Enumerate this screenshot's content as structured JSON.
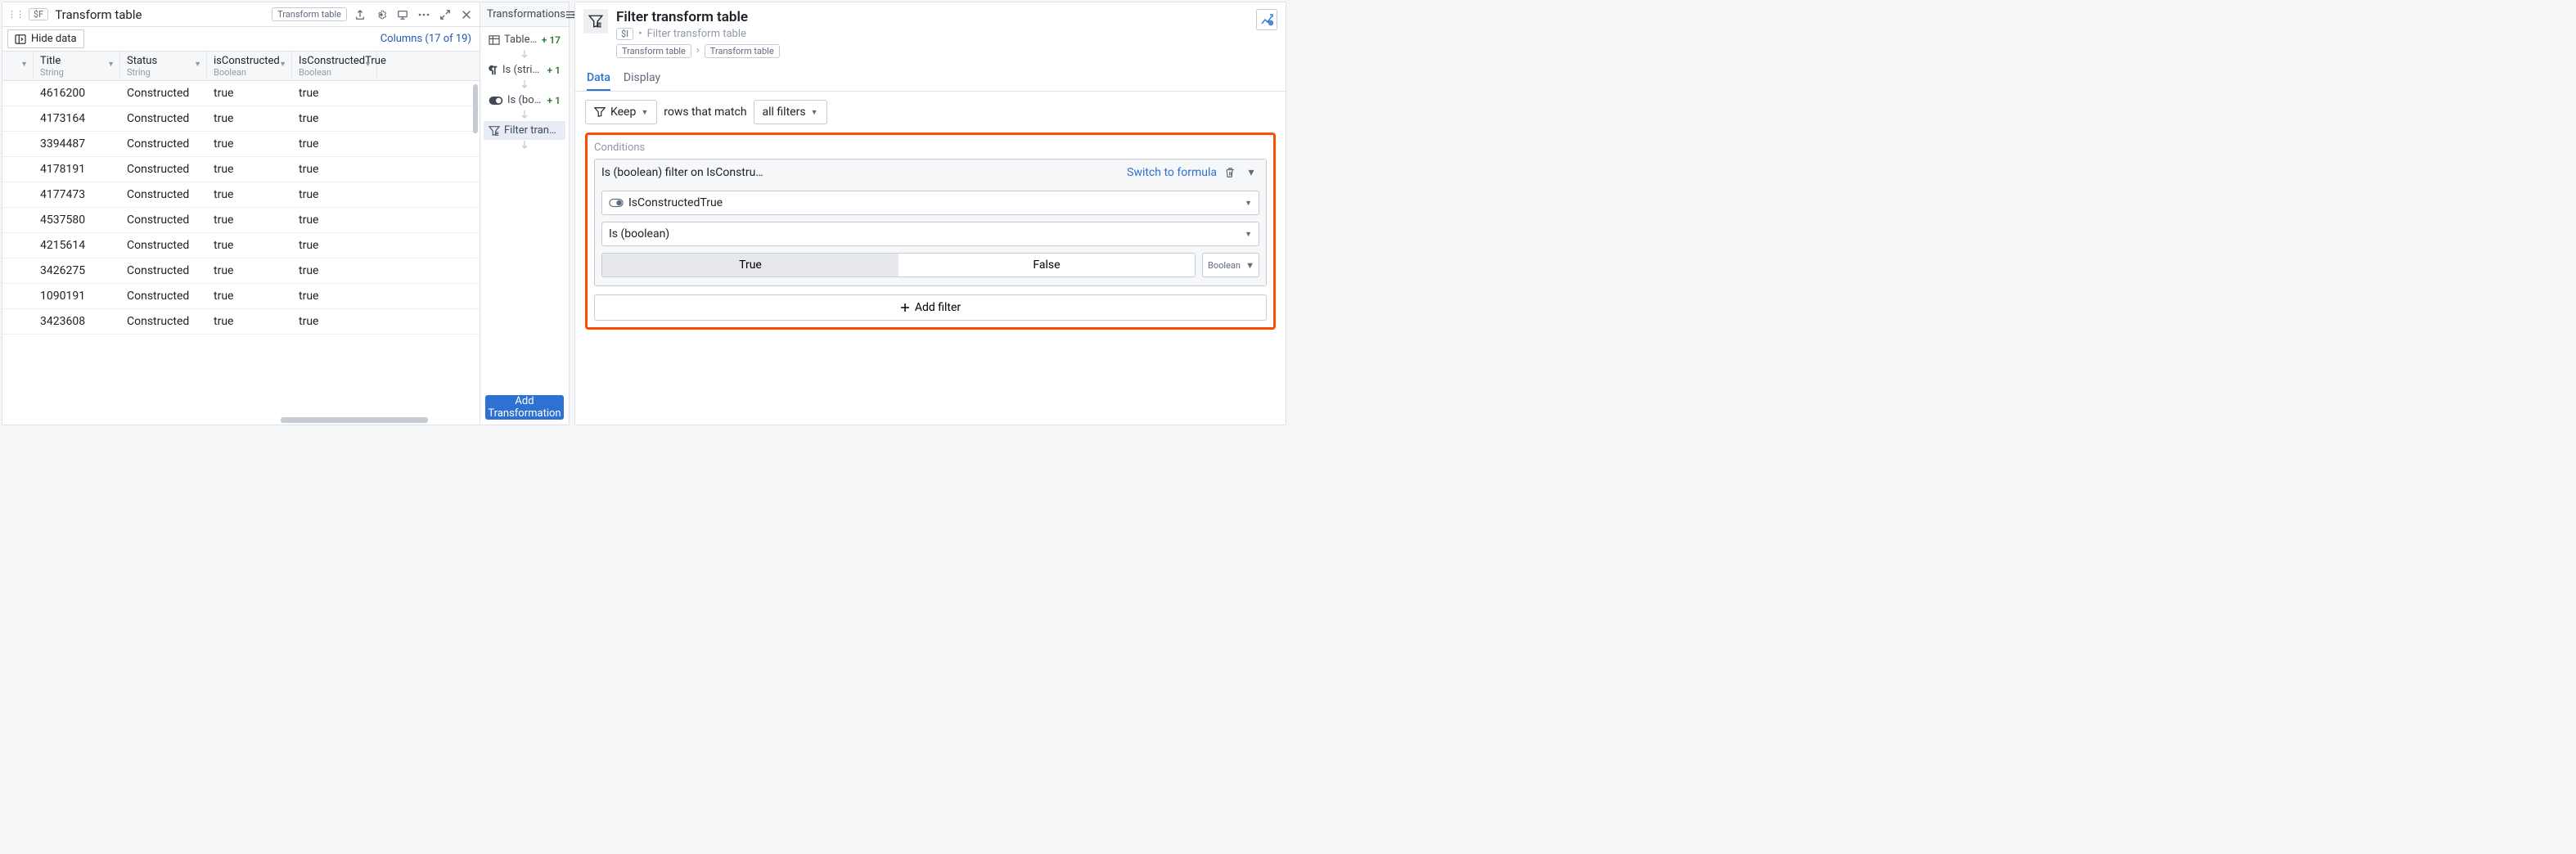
{
  "left": {
    "badge": "$F",
    "title": "Transform table",
    "card_tag": "Transform table",
    "hide_data": "Hide data",
    "columns_link": "Columns (17 of 19)",
    "columns": [
      {
        "label": "Title",
        "type": "String"
      },
      {
        "label": "Status",
        "type": "String"
      },
      {
        "label": "isConstructed",
        "type": "Boolean"
      },
      {
        "label": "IsConstructedTrue",
        "type": "Boolean"
      }
    ],
    "rows": [
      {
        "title": "4616200",
        "status": "Constructed",
        "isc": "true",
        "ict": "true"
      },
      {
        "title": "4173164",
        "status": "Constructed",
        "isc": "true",
        "ict": "true"
      },
      {
        "title": "3394487",
        "status": "Constructed",
        "isc": "true",
        "ict": "true"
      },
      {
        "title": "4178191",
        "status": "Constructed",
        "isc": "true",
        "ict": "true"
      },
      {
        "title": "4177473",
        "status": "Constructed",
        "isc": "true",
        "ict": "true"
      },
      {
        "title": "4537580",
        "status": "Constructed",
        "isc": "true",
        "ict": "true"
      },
      {
        "title": "4215614",
        "status": "Constructed",
        "isc": "true",
        "ict": "true"
      },
      {
        "title": "3426275",
        "status": "Constructed",
        "isc": "true",
        "ict": "true"
      },
      {
        "title": "1090191",
        "status": "Constructed",
        "isc": "true",
        "ict": "true"
      },
      {
        "title": "3423608",
        "status": "Constructed",
        "isc": "true",
        "ict": "true"
      }
    ]
  },
  "middle": {
    "header": "Transformations",
    "items": [
      {
        "icon": "table",
        "label": "Table from object set",
        "delta": "+ 17"
      },
      {
        "icon": "pilcrow",
        "label": "Is (string)",
        "delta": "+ 1"
      },
      {
        "icon": "toggle",
        "label": "Is (boolean)",
        "delta": "+ 1"
      },
      {
        "icon": "filter",
        "label": "Filter transform table",
        "delta": ""
      }
    ],
    "add": "Add Transformation"
  },
  "right": {
    "title": "Filter transform table",
    "id_badge": "$I",
    "subtitle": "Filter transform table",
    "crumbs": [
      "Transform table",
      "Transform table"
    ],
    "tabs": [
      "Data",
      "Display"
    ],
    "keep": "Keep",
    "rows_match": "rows that match",
    "all_filters": "all filters",
    "conditions_label": "Conditions",
    "cond_title": "Is (boolean) filter on IsConstru…",
    "switch_formula": "Switch to formula",
    "column_sel": "IsConstructedTrue",
    "op_sel": "Is (boolean)",
    "true": "True",
    "false": "False",
    "type": "Boolean",
    "add_filter": "Add filter"
  }
}
